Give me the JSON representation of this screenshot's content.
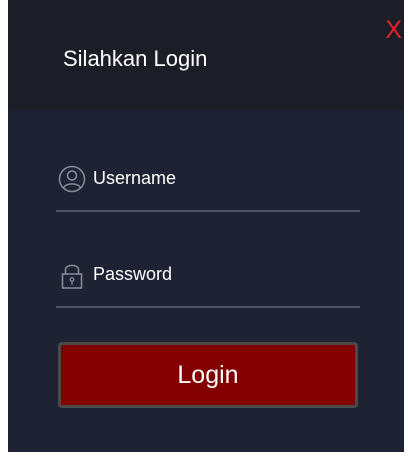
{
  "dialog": {
    "title": "Silahkan Login",
    "close_label": "X"
  },
  "form": {
    "username": {
      "placeholder": "Username",
      "icon": "user-icon"
    },
    "password": {
      "placeholder": "Password",
      "icon": "lock-icon"
    },
    "login_label": "Login"
  },
  "colors": {
    "background": "#1f2233",
    "header": "#1b1d27",
    "close": "#e8202a",
    "button": "#820000",
    "underline": "#4e5261"
  }
}
